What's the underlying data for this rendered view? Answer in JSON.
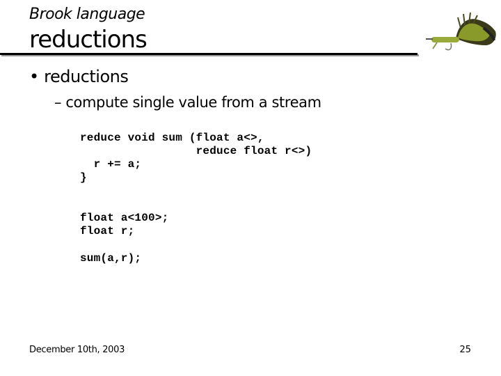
{
  "header": {
    "subtitle": "Brook language",
    "title": "reductions"
  },
  "logo": {
    "icon": "fly-fishing-lure-icon"
  },
  "content": {
    "bullet": {
      "marker": "•",
      "text": "reductions"
    },
    "subbullet": {
      "marker": "–",
      "text": "compute single value from a stream"
    },
    "code_blocks": [
      "reduce void sum (float a<>,\n                 reduce float r<>)\n  r += a;\n}",
      "float a<100>;\nfloat r;",
      "sum(a,r);"
    ]
  },
  "footer": {
    "date": "December 10th, 2003",
    "page_number": "25"
  }
}
